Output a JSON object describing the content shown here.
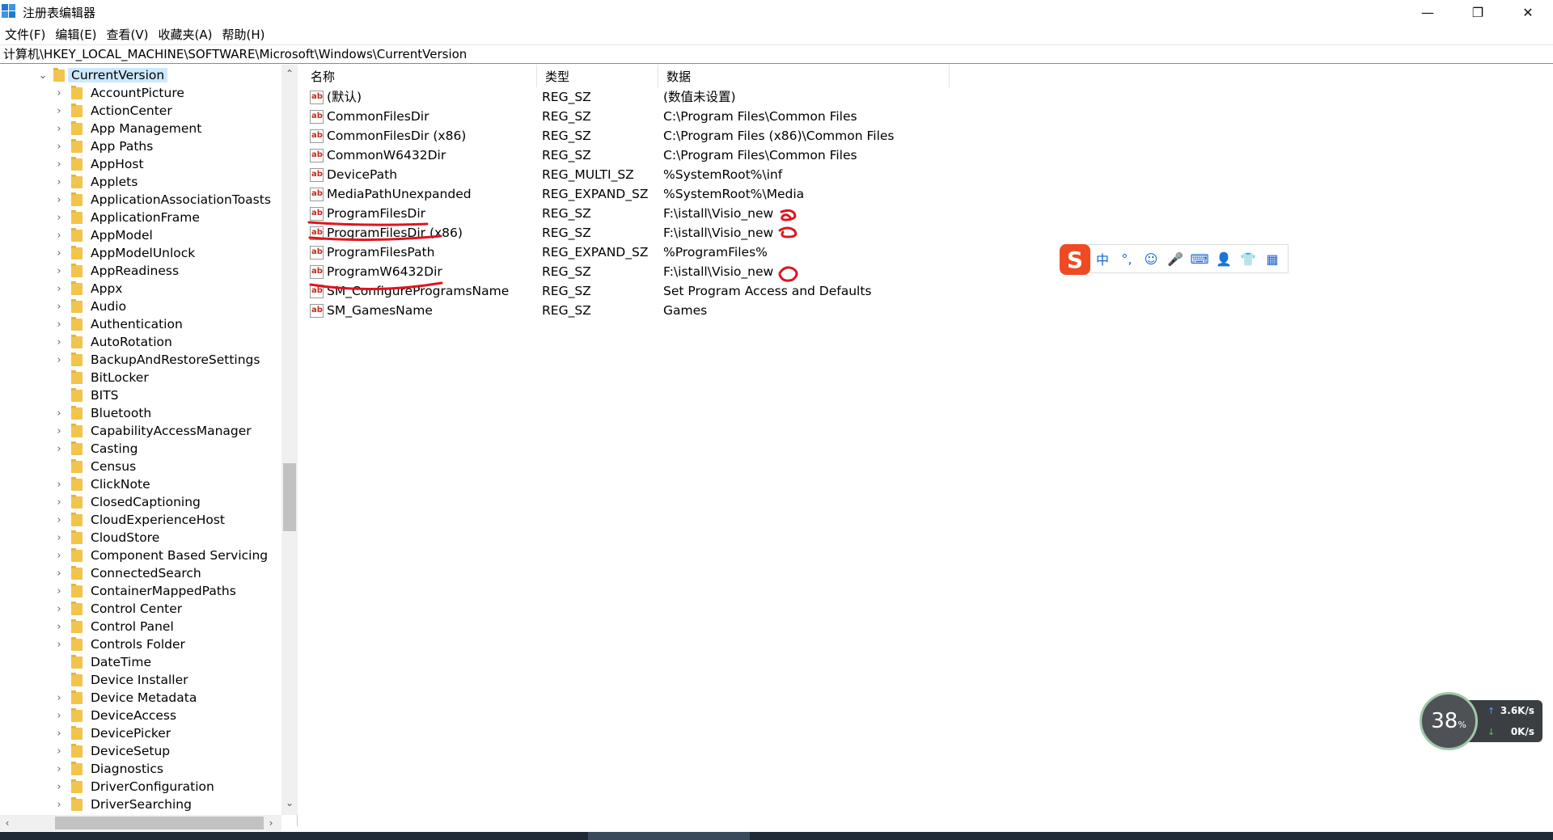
{
  "window": {
    "title": "注册表编辑器",
    "controls": {
      "minimize": "—",
      "restore": "❐",
      "close": "✕"
    }
  },
  "menu": [
    "文件(F)",
    "编辑(E)",
    "查看(V)",
    "收藏夹(A)",
    "帮助(H)"
  ],
  "address": "计算机\\HKEY_LOCAL_MACHINE\\SOFTWARE\\Microsoft\\Windows\\CurrentVersion",
  "tree": {
    "selected": "CurrentVersion",
    "items": [
      "AccountPicture",
      "ActionCenter",
      "App Management",
      "App Paths",
      "AppHost",
      "Applets",
      "ApplicationAssociationToasts",
      "ApplicationFrame",
      "AppModel",
      "AppModelUnlock",
      "AppReadiness",
      "Appx",
      "Audio",
      "Authentication",
      "AutoRotation",
      "BackupAndRestoreSettings",
      "BitLocker",
      "BITS",
      "Bluetooth",
      "CapabilityAccessManager",
      "Casting",
      "Census",
      "ClickNote",
      "ClosedCaptioning",
      "CloudExperienceHost",
      "CloudStore",
      "Component Based Servicing",
      "ConnectedSearch",
      "ContainerMappedPaths",
      "Control Center",
      "Control Panel",
      "Controls Folder",
      "DateTime",
      "Device Installer",
      "Device Metadata",
      "DeviceAccess",
      "DevicePicker",
      "DeviceSetup",
      "Diagnostics",
      "DriverConfiguration",
      "DriverSearching"
    ],
    "no_chevron": [
      "BitLocker",
      "BITS",
      "Census",
      "DateTime",
      "Device Installer"
    ]
  },
  "list": {
    "headers": {
      "name": "名称",
      "type": "类型",
      "data": "数据"
    },
    "rows": [
      {
        "name": "(默认)",
        "type": "REG_SZ",
        "data": "(数值未设置)"
      },
      {
        "name": "CommonFilesDir",
        "type": "REG_SZ",
        "data": "C:\\Program Files\\Common Files"
      },
      {
        "name": "CommonFilesDir (x86)",
        "type": "REG_SZ",
        "data": "C:\\Program Files (x86)\\Common Files"
      },
      {
        "name": "CommonW6432Dir",
        "type": "REG_SZ",
        "data": "C:\\Program Files\\Common Files"
      },
      {
        "name": "DevicePath",
        "type": "REG_MULTI_SZ",
        "data": "%SystemRoot%\\inf"
      },
      {
        "name": "MediaPathUnexpanded",
        "type": "REG_EXPAND_SZ",
        "data": "%SystemRoot%\\Media"
      },
      {
        "name": "ProgramFilesDir",
        "type": "REG_SZ",
        "data": "F:\\istall\\Visio_new"
      },
      {
        "name": "ProgramFilesDir (x86)",
        "type": "REG_SZ",
        "data": "F:\\istall\\Visio_new"
      },
      {
        "name": "ProgramFilesPath",
        "type": "REG_EXPAND_SZ",
        "data": "%ProgramFiles%"
      },
      {
        "name": "ProgramW6432Dir",
        "type": "REG_SZ",
        "data": "F:\\istall\\Visio_new"
      },
      {
        "name": "SM_ConfigureProgramsName",
        "type": "REG_SZ",
        "data": "Set Program Access and Defaults"
      },
      {
        "name": "SM_GamesName",
        "type": "REG_SZ",
        "data": "Games"
      }
    ],
    "value_icon_text": "ab"
  },
  "ime_toolbar": {
    "logo": "S",
    "items": [
      "中",
      "°,",
      "☺",
      "🎤",
      "⌨",
      "👤",
      "👕",
      "▦"
    ]
  },
  "network_widget": {
    "percent": "38",
    "percent_unit": "%",
    "upload": "3.6K/s",
    "download": "0K/s"
  },
  "colors": {
    "selection": "#cce8ff",
    "folder": "#f2c44b",
    "annotation_red": "#e0141e",
    "ime_logo": "#f04a23"
  }
}
